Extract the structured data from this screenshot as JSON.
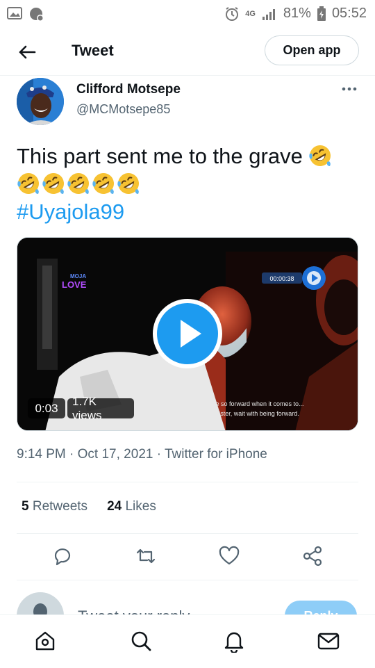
{
  "status_bar": {
    "network": "4G",
    "battery": "81%",
    "time": "05:52"
  },
  "header": {
    "title": "Tweet",
    "open_app_label": "Open app"
  },
  "author": {
    "name": "Clifford Motsepe",
    "handle": "@MCMotsepe85"
  },
  "tweet": {
    "text": "This part sent me to the grave",
    "hashtag": "#Uyajola99",
    "emoji_name": "rolling-on-the-floor-laughing"
  },
  "media": {
    "duration": "0:03",
    "views": "1.7K views",
    "overlay_brand": "MOJA\nLOVE",
    "overlay_timer": "00:00:38",
    "caption_line1": "are so forward when it comes to...",
    "caption_line2": "Sister, wait with being forward."
  },
  "meta": {
    "time": "9:14 PM",
    "date": "Oct 17, 2021",
    "source": "Twitter for iPhone"
  },
  "stats": {
    "retweets_count": "5",
    "retweets_label": "Retweets",
    "likes_count": "24",
    "likes_label": "Likes"
  },
  "reply": {
    "placeholder": "Tweet your reply",
    "button": "Reply"
  },
  "colors": {
    "accent": "#1d9bf0",
    "text": "#0f1419",
    "muted": "#536471"
  }
}
